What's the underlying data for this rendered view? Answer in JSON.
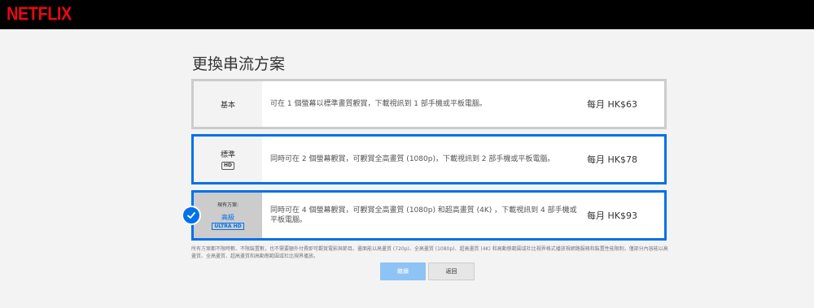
{
  "header": {
    "logo": "NETFLIX"
  },
  "page": {
    "title": "更換串流方案"
  },
  "plans": [
    {
      "name": "基本",
      "description": "可在 1 個螢幕以標準畫質觀賞，下載視訊到 1 部手機或平板電腦。",
      "price": "每月 HK$63"
    },
    {
      "name": "標準",
      "badge": "HD",
      "description": "同時可在 2 個螢幕觀賞，可觀賞全高畫質 (1080p)，下載視訊到 2 部手機或平板電腦。",
      "price": "每月 HK$78"
    },
    {
      "current_label": "現有方案:",
      "name": "高級",
      "badge": "ULTRA HD",
      "description": "同時可在 4 個螢幕觀賞，可觀賞全高畫質 (1080p) 和超高畫質 (4K) ，下載視訊到 4 部手機或平板電腦。",
      "price": "每月 HK$93"
    }
  ],
  "footnote": "所有方案都不限時數、不限裝置數，也不需要額外付費即可觀賞電影與節目。畫面能以高畫質 (720p)、全高畫質 (1080p)、超高畫質 (4K) 和高動態範圍或杜比視界格式播放視網路服務和裝置性能限制，僅部分內容能以高畫質、全高畫質、超高畫質和高動態範圍或杜比視界播放。",
  "buttons": {
    "continue": "繼續",
    "back": "返回"
  },
  "colors": {
    "accent": "#0071eb",
    "brand": "#e50914"
  }
}
